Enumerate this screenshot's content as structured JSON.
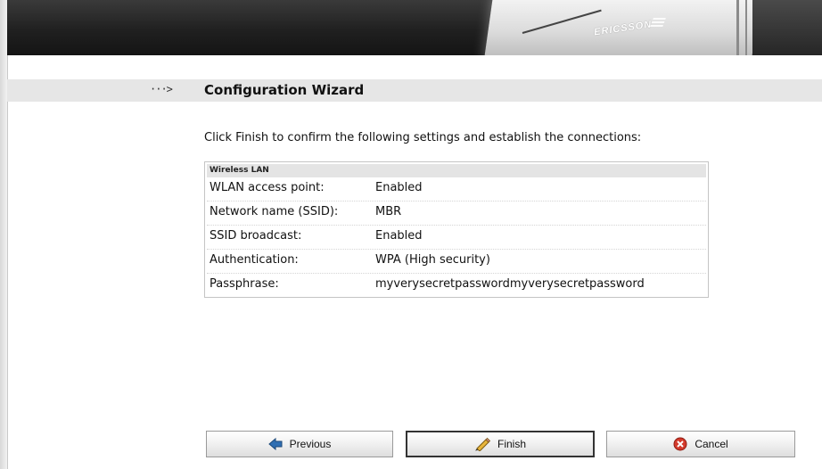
{
  "header": {
    "brand": "ERICSSON",
    "brand_icon": "ericsson-logo-icon"
  },
  "page": {
    "title": "Configuration Wizard",
    "title_icon": "arrow-right-icon",
    "title_marker": "···>",
    "instruction": "Click Finish to confirm the following settings and establish the connections:"
  },
  "summary": {
    "section_title": "Wireless LAN",
    "rows": [
      {
        "label": "WLAN access point:",
        "value": "Enabled"
      },
      {
        "label": "Network name (SSID):",
        "value": "MBR"
      },
      {
        "label": "SSID broadcast:",
        "value": "Enabled"
      },
      {
        "label": "Authentication:",
        "value": "WPA (High security)"
      },
      {
        "label": "Passphrase:",
        "value": "myverysecretpasswordmyverysecretpassword"
      }
    ]
  },
  "buttons": {
    "previous": {
      "label": "Previous",
      "icon": "arrow-left-icon"
    },
    "finish": {
      "label": "Finish",
      "icon": "pencil-icon"
    },
    "cancel": {
      "label": "Cancel",
      "icon": "cancel-x-icon"
    }
  },
  "colors": {
    "banner": "#1c1c1c",
    "title_bar": "#e6e6e6",
    "previous_icon": "#2f6fb3",
    "finish_icon": "#e8b63c",
    "cancel_icon": "#d33a2c"
  }
}
